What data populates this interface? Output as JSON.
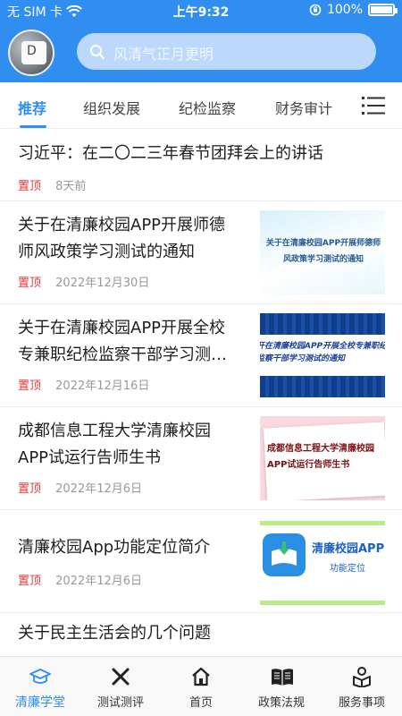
{
  "status_bar": {
    "carrier": "无 SIM 卡",
    "time": "上午9:32",
    "battery": "100%"
  },
  "avatar": {
    "key_letter": "D"
  },
  "search": {
    "placeholder": "风清气正月更明"
  },
  "tabs": [
    {
      "label": "推荐",
      "active": true
    },
    {
      "label": "组织发展",
      "active": false
    },
    {
      "label": "纪检监察",
      "active": false
    },
    {
      "label": "财务审计",
      "active": false
    }
  ],
  "news": [
    {
      "title": "习近平：在二〇二三年春节团拜会上的讲话",
      "tag": "置顶",
      "date": "8天前"
    },
    {
      "title_line1": "关于在清廉校园APP开展师德",
      "title_line2": "师风政策学习测试的通知",
      "tag": "置顶",
      "date": "2022年12月30日",
      "thumb_text": "关于在清廉校园APP开展师德师风政策学习测试的通知"
    },
    {
      "title_line1": "关于在清廉校园APP开展全校",
      "title_line2": "专兼职纪检监察干部学习测…",
      "tag": "置顶",
      "date": "2022年12月16日",
      "thumb_text": "开在清廉校园APP开展全校专兼职纪检监察干部学习测试的通知"
    },
    {
      "title_line1": "成都信息工程大学清廉校园",
      "title_line2": "APP试运行告师生书",
      "tag": "置顶",
      "date": "2022年12月6日",
      "thumb_text": "成都信息工程大学清廉校园APP试运行告师生书"
    },
    {
      "title": "清廉校园App功能定位简介",
      "tag": "置顶",
      "date": "2022年12月6日",
      "thumb_name": "清廉校园APP",
      "thumb_sub": "功能定位"
    },
    {
      "title": "关于民主生活会的几个问题"
    }
  ],
  "bottom_nav": [
    {
      "label": "清廉学堂",
      "active": true
    },
    {
      "label": "测试测评",
      "active": false
    },
    {
      "label": "首页",
      "active": false
    },
    {
      "label": "政策法规",
      "active": false
    },
    {
      "label": "服务事项",
      "active": false
    }
  ],
  "colors": {
    "primary": "#2f8ef0",
    "tag_red": "#e13a3a"
  }
}
